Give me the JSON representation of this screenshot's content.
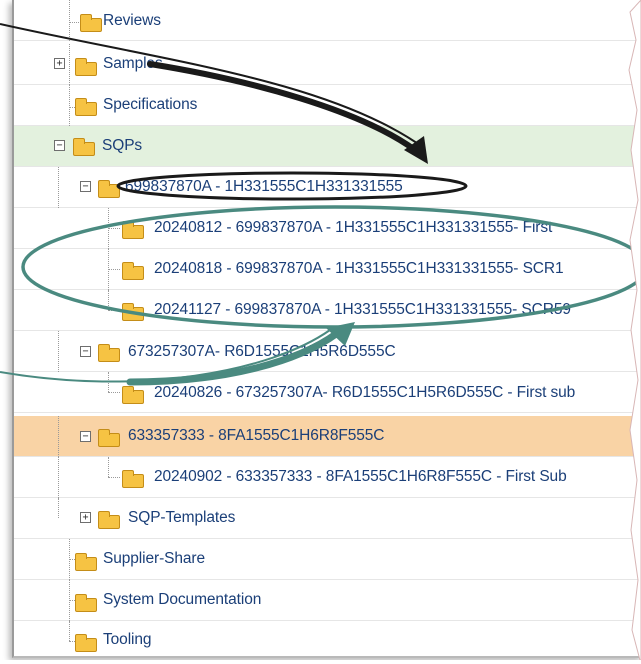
{
  "tree": {
    "items": [
      {
        "label": "Reviews",
        "selected": "none"
      },
      {
        "label": "Samples",
        "selected": "none"
      },
      {
        "label": "Specifications",
        "selected": "none"
      },
      {
        "label": "SQPs",
        "selected": "green"
      },
      {
        "label": "699837870A - 1H331555C1H331331555",
        "selected": "none"
      },
      {
        "label": "20240812 - 699837870A - 1H331555C1H331331555-  First",
        "selected": "none"
      },
      {
        "label": "20240818 - 699837870A - 1H331555C1H331331555- SCR1",
        "selected": "none"
      },
      {
        "label": "20241127 - 699837870A - 1H331555C1H331331555- SCR59",
        "selected": "none"
      },
      {
        "label": "673257307A-   R6D1555C1H5R6D555C",
        "selected": "none"
      },
      {
        "label": "20240826 - 673257307A-   R6D1555C1H5R6D555C  - First sub",
        "selected": "none"
      },
      {
        "label": "633357333 -    8FA1555C1H6R8F555C",
        "selected": "orange"
      },
      {
        "label": "20240902 - 633357333 -    8FA1555C1H6R8F555C  - First Sub",
        "selected": "none"
      },
      {
        "label": "SQP-Templates",
        "selected": "none"
      },
      {
        "label": "Supplier-Share",
        "selected": "none"
      },
      {
        "label": "System Documentation",
        "selected": "none"
      },
      {
        "label": "Tooling",
        "selected": "none"
      }
    ]
  },
  "colors": {
    "label_text": "#1b3f78",
    "selected_green": "#e3f1de",
    "selected_orange": "#f9d3a5",
    "folder_fill": "#f6c343",
    "annotation_black": "#1a1a1a",
    "annotation_teal": "#4a8a80"
  },
  "icons": [
    "folder-icon",
    "expand-icon",
    "collapse-icon"
  ]
}
